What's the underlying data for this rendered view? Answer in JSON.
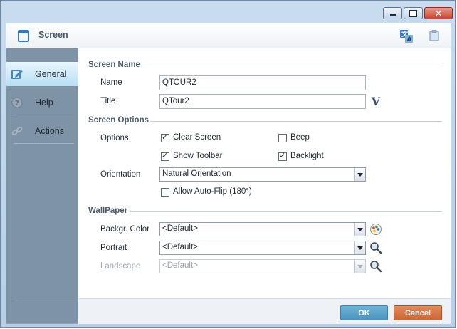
{
  "window": {
    "title": "Screen",
    "controls": [
      "minimize",
      "maximize",
      "close"
    ]
  },
  "header": {
    "title": "Screen",
    "icons": [
      "screen-icon",
      "translate-icon",
      "clipboard-icon"
    ]
  },
  "sidebar": {
    "items": [
      {
        "label": "General",
        "icon": "edit-icon",
        "active": true
      },
      {
        "label": "Help",
        "icon": "help-icon",
        "active": false
      },
      {
        "label": "Actions",
        "icon": "link-icon",
        "active": false
      }
    ]
  },
  "screen_name": {
    "section_label": "Screen Name",
    "name_label": "Name",
    "name_value": "QTOUR2",
    "title_label": "Title",
    "title_value": "QTour2",
    "variable_button": "V"
  },
  "screen_options": {
    "section_label": "Screen Options",
    "options_label": "Options",
    "clear_screen_label": "Clear Screen",
    "clear_screen_checked": true,
    "beep_label": "Beep",
    "beep_checked": false,
    "show_toolbar_label": "Show Toolbar",
    "show_toolbar_checked": true,
    "backlight_label": "Backlight",
    "backlight_checked": true,
    "orientation_label": "Orientation",
    "orientation_value": "Natural Orientation",
    "auto_flip_label": "Allow Auto-Flip (180°)",
    "auto_flip_checked": false
  },
  "wallpaper": {
    "section_label": "WallPaper",
    "background_label": "Backgr. Color",
    "background_value": "<Default>",
    "portrait_label": "Portrait",
    "portrait_value": "<Default>",
    "landscape_label": "Landscape",
    "landscape_value": "<Default>"
  },
  "footer": {
    "ok_label": "OK",
    "cancel_label": "Cancel"
  },
  "colors": {
    "ok": "#4a94bf",
    "cancel": "#cc6635",
    "sidebar": "#7f93a6",
    "active_nav": "#b7def4"
  }
}
